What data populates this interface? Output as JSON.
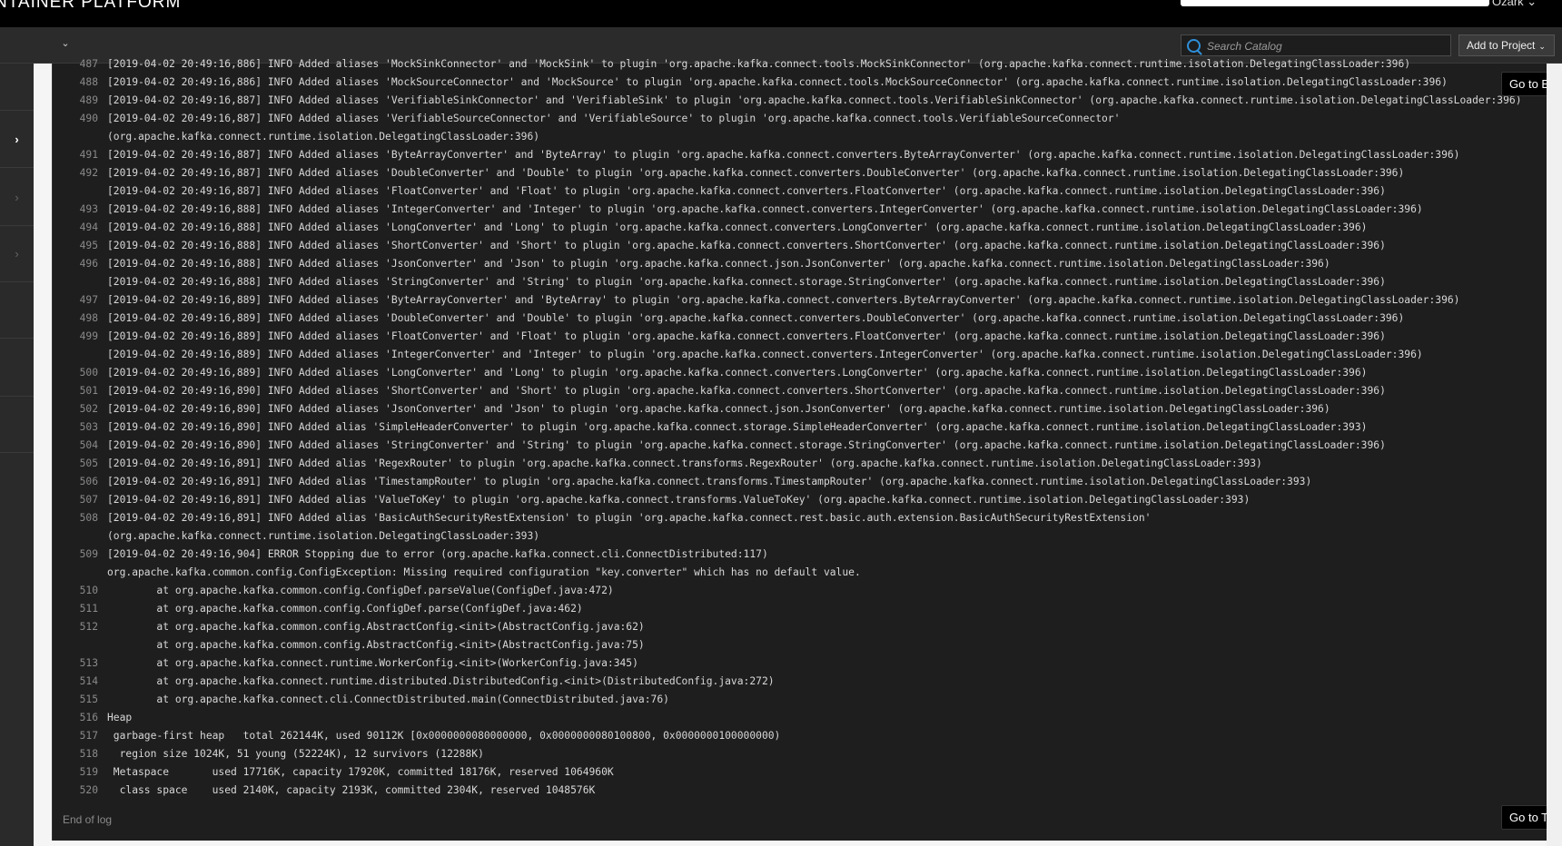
{
  "header": {
    "brand": "NTAINER PLATFORM",
    "user_menu": "Ozark ⌄"
  },
  "toolbar": {
    "search_placeholder": "Search Catalog",
    "add_project_label": "Add to Project",
    "toggle_icon": "chevron-down-icon"
  },
  "leftnav": {
    "items": [
      {
        "icon": "",
        "active": false
      },
      {
        "icon": "›",
        "active": true
      },
      {
        "icon": "›",
        "active": false
      },
      {
        "icon": "›",
        "active": false
      },
      {
        "icon": "",
        "active": false
      },
      {
        "icon": "",
        "active": false
      },
      {
        "icon": "",
        "active": false
      }
    ]
  },
  "log": {
    "go_to_end": "Go to End",
    "go_to_top": "Go to Top",
    "end_of_log": "End of log",
    "lines": [
      {
        "n": "487",
        "t": "[2019-04-02 20:49:16,886] INFO Added aliases 'MockSinkConnector' and 'MockSink' to plugin 'org.apache.kafka.connect.tools.MockSinkConnector' (org.apache.kafka.connect.runtime.isolation.DelegatingClassLoader:396)"
      },
      {
        "n": "488",
        "t": "[2019-04-02 20:49:16,886] INFO Added aliases 'MockSourceConnector' and 'MockSource' to plugin 'org.apache.kafka.connect.tools.MockSourceConnector' (org.apache.kafka.connect.runtime.isolation.DelegatingClassLoader:396)"
      },
      {
        "n": "489",
        "t": "[2019-04-02 20:49:16,887] INFO Added aliases 'VerifiableSinkConnector' and 'VerifiableSink' to plugin 'org.apache.kafka.connect.tools.VerifiableSinkConnector' (org.apache.kafka.connect.runtime.isolation.DelegatingClassLoader:396)"
      },
      {
        "n": "490",
        "t": "[2019-04-02 20:49:16,887] INFO Added aliases 'VerifiableSourceConnector' and 'VerifiableSource' to plugin 'org.apache.kafka.connect.tools.VerifiableSourceConnector'"
      },
      {
        "n": "",
        "t": "(org.apache.kafka.connect.runtime.isolation.DelegatingClassLoader:396)"
      },
      {
        "n": "491",
        "t": "[2019-04-02 20:49:16,887] INFO Added aliases 'ByteArrayConverter' and 'ByteArray' to plugin 'org.apache.kafka.connect.converters.ByteArrayConverter' (org.apache.kafka.connect.runtime.isolation.DelegatingClassLoader:396)"
      },
      {
        "n": "492",
        "t": "[2019-04-02 20:49:16,887] INFO Added aliases 'DoubleConverter' and 'Double' to plugin 'org.apache.kafka.connect.converters.DoubleConverter' (org.apache.kafka.connect.runtime.isolation.DelegatingClassLoader:396)"
      },
      {
        "n": "",
        "t": "[2019-04-02 20:49:16,887] INFO Added aliases 'FloatConverter' and 'Float' to plugin 'org.apache.kafka.connect.converters.FloatConverter' (org.apache.kafka.connect.runtime.isolation.DelegatingClassLoader:396)"
      },
      {
        "n": "493",
        "t": "[2019-04-02 20:49:16,888] INFO Added aliases 'IntegerConverter' and 'Integer' to plugin 'org.apache.kafka.connect.converters.IntegerConverter' (org.apache.kafka.connect.runtime.isolation.DelegatingClassLoader:396)"
      },
      {
        "n": "494",
        "t": "[2019-04-02 20:49:16,888] INFO Added aliases 'LongConverter' and 'Long' to plugin 'org.apache.kafka.connect.converters.LongConverter' (org.apache.kafka.connect.runtime.isolation.DelegatingClassLoader:396)"
      },
      {
        "n": "495",
        "t": "[2019-04-02 20:49:16,888] INFO Added aliases 'ShortConverter' and 'Short' to plugin 'org.apache.kafka.connect.converters.ShortConverter' (org.apache.kafka.connect.runtime.isolation.DelegatingClassLoader:396)"
      },
      {
        "n": "496",
        "t": "[2019-04-02 20:49:16,888] INFO Added aliases 'JsonConverter' and 'Json' to plugin 'org.apache.kafka.connect.json.JsonConverter' (org.apache.kafka.connect.runtime.isolation.DelegatingClassLoader:396)"
      },
      {
        "n": "",
        "t": "[2019-04-02 20:49:16,888] INFO Added aliases 'StringConverter' and 'String' to plugin 'org.apache.kafka.connect.storage.StringConverter' (org.apache.kafka.connect.runtime.isolation.DelegatingClassLoader:396)"
      },
      {
        "n": "497",
        "t": "[2019-04-02 20:49:16,889] INFO Added aliases 'ByteArrayConverter' and 'ByteArray' to plugin 'org.apache.kafka.connect.converters.ByteArrayConverter' (org.apache.kafka.connect.runtime.isolation.DelegatingClassLoader:396)"
      },
      {
        "n": "498",
        "t": "[2019-04-02 20:49:16,889] INFO Added aliases 'DoubleConverter' and 'Double' to plugin 'org.apache.kafka.connect.converters.DoubleConverter' (org.apache.kafka.connect.runtime.isolation.DelegatingClassLoader:396)"
      },
      {
        "n": "499",
        "t": "[2019-04-02 20:49:16,889] INFO Added aliases 'FloatConverter' and 'Float' to plugin 'org.apache.kafka.connect.converters.FloatConverter' (org.apache.kafka.connect.runtime.isolation.DelegatingClassLoader:396)"
      },
      {
        "n": "",
        "t": "[2019-04-02 20:49:16,889] INFO Added aliases 'IntegerConverter' and 'Integer' to plugin 'org.apache.kafka.connect.converters.IntegerConverter' (org.apache.kafka.connect.runtime.isolation.DelegatingClassLoader:396)"
      },
      {
        "n": "500",
        "t": "[2019-04-02 20:49:16,889] INFO Added aliases 'LongConverter' and 'Long' to plugin 'org.apache.kafka.connect.converters.LongConverter' (org.apache.kafka.connect.runtime.isolation.DelegatingClassLoader:396)"
      },
      {
        "n": "501",
        "t": "[2019-04-02 20:49:16,890] INFO Added aliases 'ShortConverter' and 'Short' to plugin 'org.apache.kafka.connect.converters.ShortConverter' (org.apache.kafka.connect.runtime.isolation.DelegatingClassLoader:396)"
      },
      {
        "n": "502",
        "t": "[2019-04-02 20:49:16,890] INFO Added aliases 'JsonConverter' and 'Json' to plugin 'org.apache.kafka.connect.json.JsonConverter' (org.apache.kafka.connect.runtime.isolation.DelegatingClassLoader:396)"
      },
      {
        "n": "503",
        "t": "[2019-04-02 20:49:16,890] INFO Added alias 'SimpleHeaderConverter' to plugin 'org.apache.kafka.connect.storage.SimpleHeaderConverter' (org.apache.kafka.connect.runtime.isolation.DelegatingClassLoader:393)"
      },
      {
        "n": "504",
        "t": "[2019-04-02 20:49:16,890] INFO Added aliases 'StringConverter' and 'String' to plugin 'org.apache.kafka.connect.storage.StringConverter' (org.apache.kafka.connect.runtime.isolation.DelegatingClassLoader:396)"
      },
      {
        "n": "505",
        "t": "[2019-04-02 20:49:16,891] INFO Added alias 'RegexRouter' to plugin 'org.apache.kafka.connect.transforms.RegexRouter' (org.apache.kafka.connect.runtime.isolation.DelegatingClassLoader:393)"
      },
      {
        "n": "506",
        "t": "[2019-04-02 20:49:16,891] INFO Added alias 'TimestampRouter' to plugin 'org.apache.kafka.connect.transforms.TimestampRouter' (org.apache.kafka.connect.runtime.isolation.DelegatingClassLoader:393)"
      },
      {
        "n": "507",
        "t": "[2019-04-02 20:49:16,891] INFO Added alias 'ValueToKey' to plugin 'org.apache.kafka.connect.transforms.ValueToKey' (org.apache.kafka.connect.runtime.isolation.DelegatingClassLoader:393)"
      },
      {
        "n": "508",
        "t": "[2019-04-02 20:49:16,891] INFO Added alias 'BasicAuthSecurityRestExtension' to plugin 'org.apache.kafka.connect.rest.basic.auth.extension.BasicAuthSecurityRestExtension'"
      },
      {
        "n": "",
        "t": "(org.apache.kafka.connect.runtime.isolation.DelegatingClassLoader:393)"
      },
      {
        "n": "509",
        "t": "[2019-04-02 20:49:16,904] ERROR Stopping due to error (org.apache.kafka.connect.cli.ConnectDistributed:117)"
      },
      {
        "n": "",
        "t": "org.apache.kafka.common.config.ConfigException: Missing required configuration \"key.converter\" which has no default value."
      },
      {
        "n": "510",
        "t": "        at org.apache.kafka.common.config.ConfigDef.parseValue(ConfigDef.java:472)"
      },
      {
        "n": "511",
        "t": "        at org.apache.kafka.common.config.ConfigDef.parse(ConfigDef.java:462)"
      },
      {
        "n": "512",
        "t": "        at org.apache.kafka.common.config.AbstractConfig.<init>(AbstractConfig.java:62)"
      },
      {
        "n": "",
        "t": "        at org.apache.kafka.common.config.AbstractConfig.<init>(AbstractConfig.java:75)"
      },
      {
        "n": "513",
        "t": "        at org.apache.kafka.connect.runtime.WorkerConfig.<init>(WorkerConfig.java:345)"
      },
      {
        "n": "514",
        "t": "        at org.apache.kafka.connect.runtime.distributed.DistributedConfig.<init>(DistributedConfig.java:272)"
      },
      {
        "n": "515",
        "t": "        at org.apache.kafka.connect.cli.ConnectDistributed.main(ConnectDistributed.java:76)"
      },
      {
        "n": "516",
        "t": "Heap"
      },
      {
        "n": "517",
        "t": " garbage-first heap   total 262144K, used 90112K [0x0000000080000000, 0x0000000080100800, 0x0000000100000000)"
      },
      {
        "n": "518",
        "t": "  region size 1024K, 51 young (52224K), 12 survivors (12288K)"
      },
      {
        "n": "519",
        "t": " Metaspace       used 17716K, capacity 17920K, committed 18176K, reserved 1064960K"
      },
      {
        "n": "520",
        "t": "  class space    used 2140K, capacity 2193K, committed 2304K, reserved 1048576K"
      }
    ]
  }
}
